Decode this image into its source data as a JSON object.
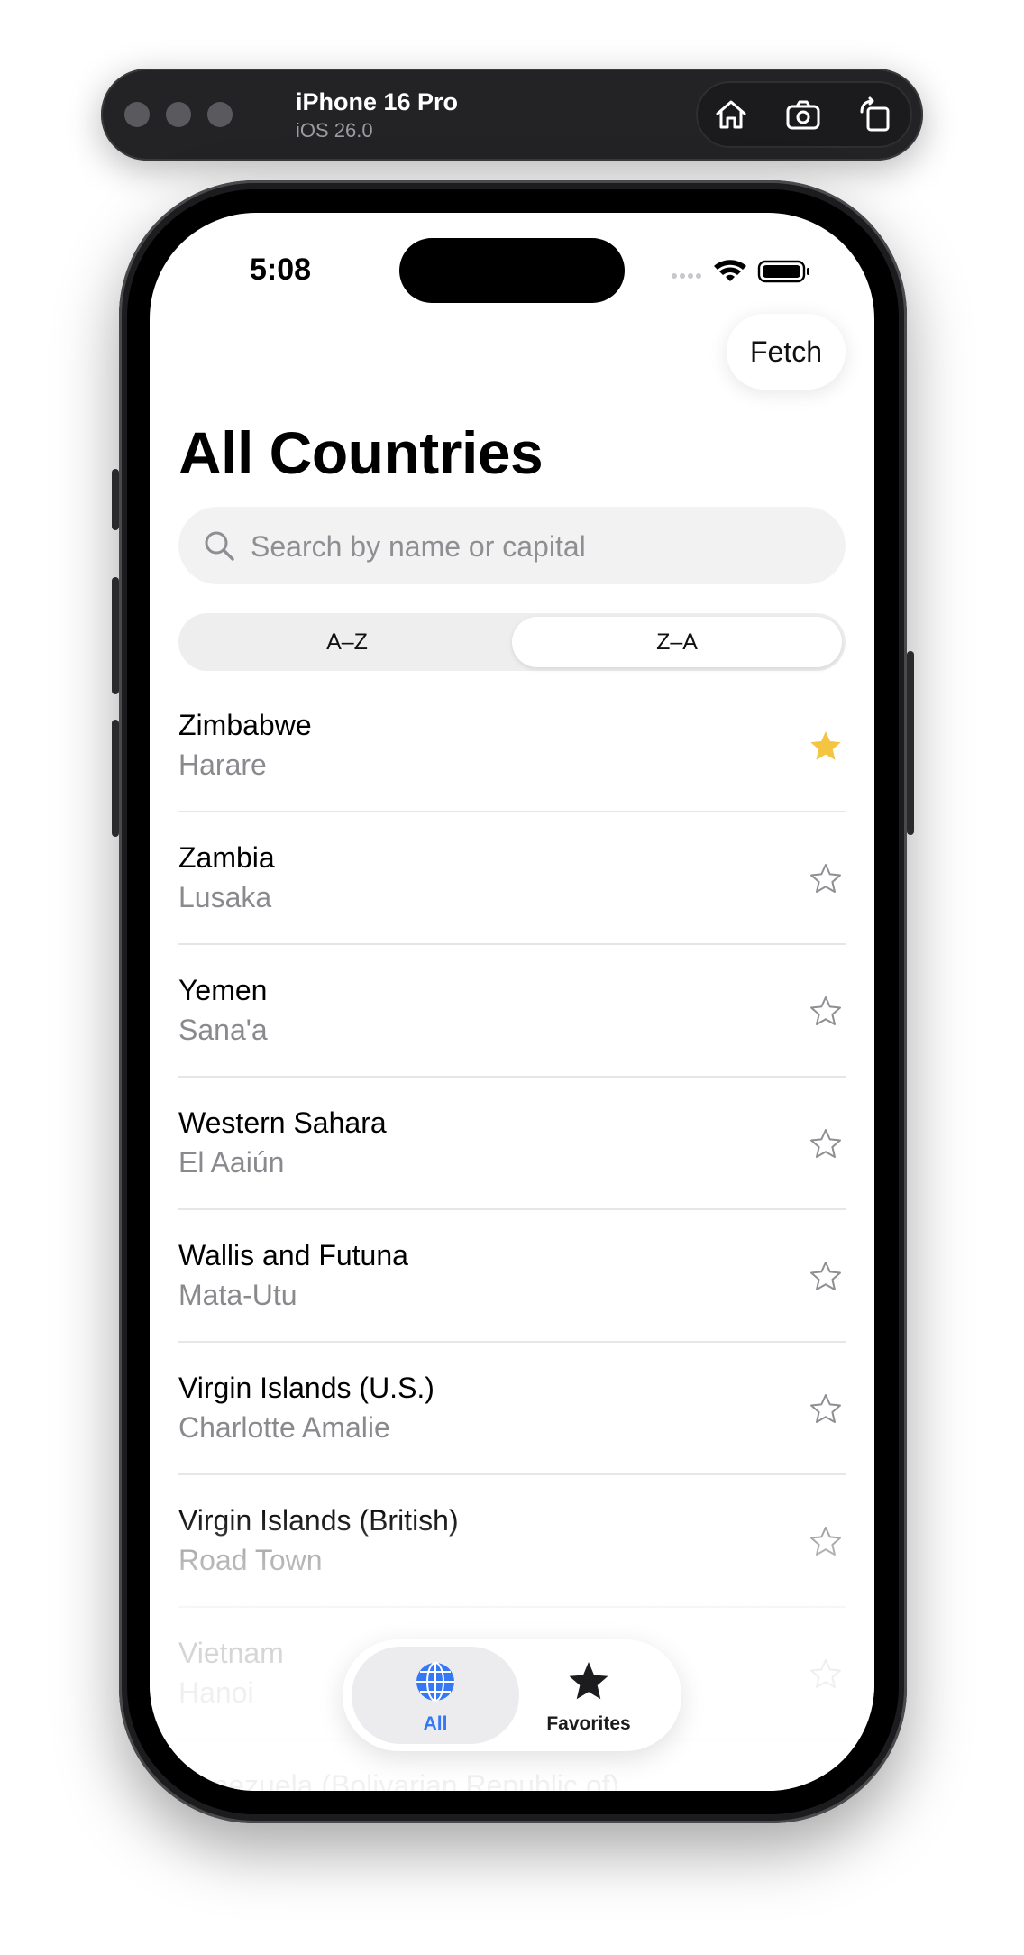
{
  "simulator": {
    "device_name": "iPhone 16 Pro",
    "os_version": "iOS 26.0",
    "actions": [
      "home-icon",
      "screenshot-icon",
      "rotate-icon"
    ]
  },
  "status_bar": {
    "time": "5:08"
  },
  "nav": {
    "fetch_label": "Fetch",
    "title": "All Countries"
  },
  "search": {
    "placeholder": "Search by name or capital",
    "value": ""
  },
  "sort": {
    "options": [
      "A–Z",
      "Z–A"
    ],
    "selected": "Z–A"
  },
  "countries": [
    {
      "name": "Zimbabwe",
      "capital": "Harare",
      "favorite": true
    },
    {
      "name": "Zambia",
      "capital": "Lusaka",
      "favorite": false
    },
    {
      "name": "Yemen",
      "capital": "Sana'a",
      "favorite": false
    },
    {
      "name": "Western Sahara",
      "capital": "El Aaiún",
      "favorite": false
    },
    {
      "name": "Wallis and Futuna",
      "capital": "Mata-Utu",
      "favorite": false
    },
    {
      "name": "Virgin Islands (U.S.)",
      "capital": "Charlotte Amalie",
      "favorite": false
    },
    {
      "name": "Virgin Islands (British)",
      "capital": "Road Town",
      "favorite": false
    },
    {
      "name": "Vietnam",
      "capital": "Hanoi",
      "favorite": false
    },
    {
      "name": "Venezuela (Bolivarian Republic of)",
      "capital": "",
      "favorite": false
    }
  ],
  "tabs": [
    {
      "label": "All",
      "icon": "globe-icon",
      "active": true
    },
    {
      "label": "Favorites",
      "icon": "star-filled-icon",
      "active": false
    }
  ],
  "colors": {
    "accent": "#3478f6",
    "favorite_star": "#f5c542",
    "secondary_text": "#8a8a8e"
  }
}
